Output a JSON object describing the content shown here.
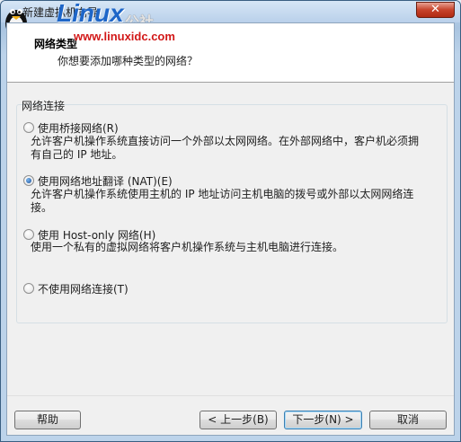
{
  "window": {
    "title": "新建虚拟机向导",
    "close_glyph": "✕"
  },
  "watermark": {
    "logo": "Linux",
    "cn": "公社",
    "url": "www.linuxidc.com"
  },
  "header": {
    "title": "网络类型",
    "subtitle": "你想要添加哪种类型的网络？"
  },
  "group": {
    "label": "网络连接",
    "options": [
      {
        "label": "使用桥接网络(R)",
        "description": "允许客户机操作系统直接访问一个外部以太网网络。在外部网络中，客户机必须拥有自己的 IP 地址。",
        "checked": false
      },
      {
        "label": "使用网络地址翻译 (NAT)(E)",
        "description": "允许客户机操作系统使用主机的 IP 地址访问主机电脑的拨号或外部以太网网络连接。",
        "checked": true
      },
      {
        "label": "使用 Host-only 网络(H)",
        "description": "使用一个私有的虚拟网络将客户机操作系统与主机电脑进行连接。",
        "checked": false
      },
      {
        "label": "不使用网络连接(T)",
        "description": "",
        "checked": false
      }
    ]
  },
  "buttons": {
    "help": "帮助",
    "back": "< 上一步(B)",
    "next": "下一步(N) >",
    "cancel": "取消"
  },
  "colors": {
    "titlebar": "#b9d0ea",
    "close_button": "#c7432b",
    "radio_selected": "#1b4f9a",
    "watermark_logo": "#1e66c8",
    "watermark_url": "#d21818"
  },
  "icons": [
    "tux-penguin-icon",
    "close-icon",
    "radio-icon"
  ]
}
